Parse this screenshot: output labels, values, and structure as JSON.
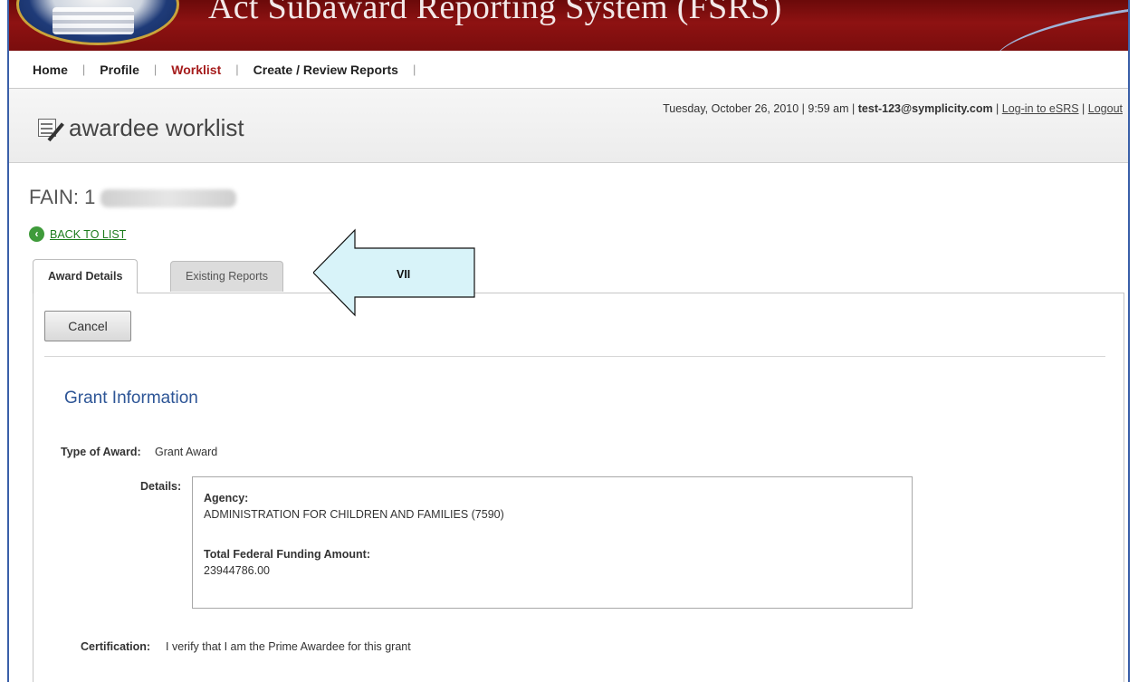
{
  "banner": {
    "title": "Act Subaward Reporting System (FSRS)"
  },
  "nav": {
    "items": [
      "Home",
      "Profile",
      "Worklist",
      "Create / Review Reports"
    ],
    "active": "Worklist"
  },
  "header": {
    "page_title": "awardee worklist",
    "date_time": "Tuesday, October 26, 2010 | 9:59 am | ",
    "user": "test-123@symplicity.com",
    "sep1": " | ",
    "login_link": "Log-in to eSRS",
    "sep2": " | ",
    "logout_link": "Logout"
  },
  "fain": {
    "label": "FAIN: 1"
  },
  "back_link": "BACK TO LIST",
  "tabs": {
    "award_details": "Award Details",
    "existing_reports": "Existing Reports"
  },
  "callout": {
    "label": "VII"
  },
  "buttons": {
    "cancel": "Cancel"
  },
  "section": {
    "title": "Grant Information"
  },
  "fields": {
    "type_label": "Type of Award:",
    "type_value": "Grant Award",
    "details_label": "Details:",
    "agency_label": "Agency:",
    "agency_value": "ADMINISTRATION FOR CHILDREN AND FAMILIES (7590)",
    "funding_label": "Total Federal Funding Amount:",
    "funding_value": "23944786.00",
    "certification_label": "Certification:",
    "certification_value": "I verify that I am the Prime Awardee for this grant"
  },
  "colors": {
    "banner": "#8e1212",
    "nav_active": "#a51c1c",
    "section_title": "#2d5596",
    "callout_fill": "#d8f3f9",
    "link_green": "#1d7c1d"
  }
}
